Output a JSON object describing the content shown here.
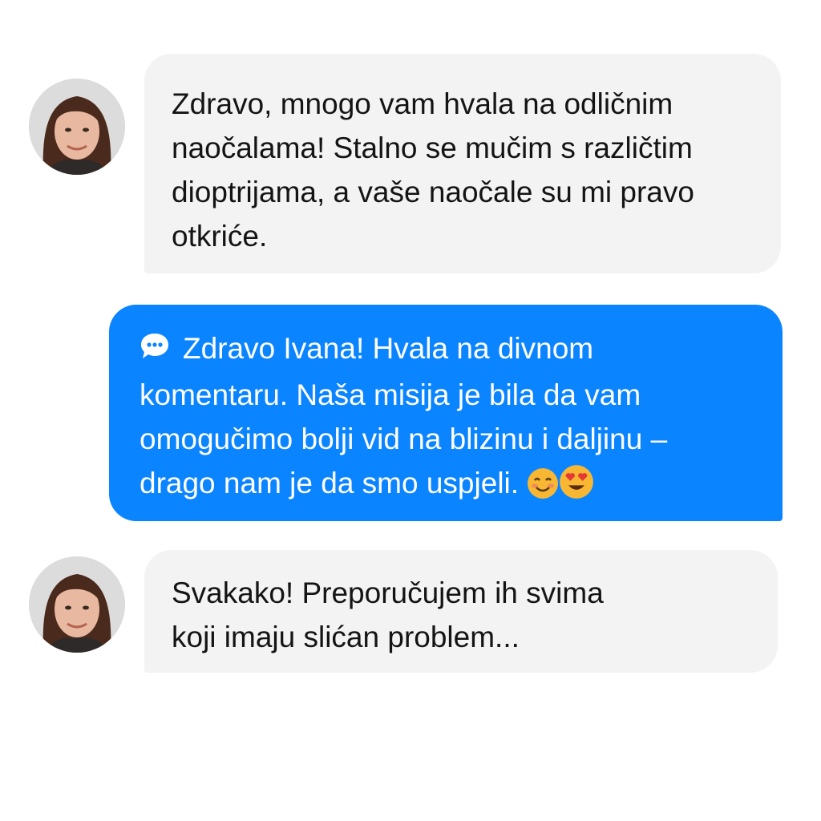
{
  "colors": {
    "incoming_bubble": "#f3f3f3",
    "outgoing_bubble": "#0a84ff",
    "incoming_text": "#141414",
    "outgoing_text": "#ffffff"
  },
  "messages": [
    {
      "sender": "Ivana",
      "direction": "incoming",
      "avatar_icon": "user-avatar",
      "lines": [
        "Zdravo, mnogo vam hvala na odličnim",
        "naočalama! Stalno se mučim s različtim",
        "dioptrijama, a vaše naočale su mi pravo",
        "otkriće."
      ]
    },
    {
      "direction": "outgoing",
      "leading_icon": "speech-bubble-icon",
      "lines": [
        "Zdravo Ivana! Hvala na divnom",
        "komentaru. Naša misija je bila da vam",
        "omogučimo bolji vid na blizinu i daljinu –",
        "drago nam je da smo uspjeli."
      ],
      "trailing_emojis": [
        "smiling-face-icon",
        "heart-eyes-face-icon"
      ]
    },
    {
      "sender": "Ivana",
      "direction": "incoming",
      "avatar_icon": "user-avatar",
      "lines": [
        "Svakako! Preporučujem ih svima",
        "koji imaju slićan problem..."
      ]
    }
  ]
}
